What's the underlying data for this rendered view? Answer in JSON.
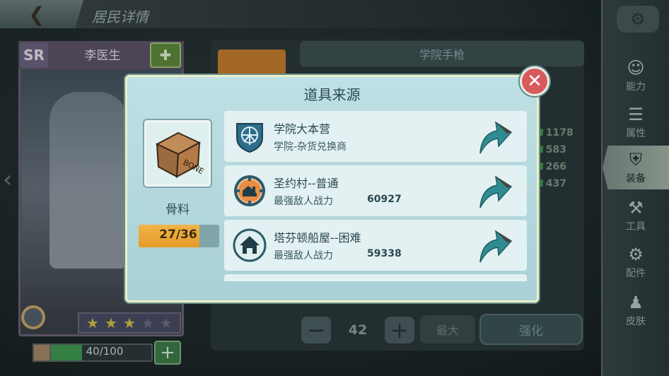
{
  "header": {
    "back_icon": "chevron-left-icon",
    "title": "居民详情"
  },
  "character": {
    "rarity": "SR",
    "name": "李医生",
    "stars_filled": 3,
    "stars_total": 5,
    "xp_text": "40/100",
    "xp_fraction": 0.4
  },
  "sidebar": {
    "items": [
      {
        "label": "能力",
        "icon": "person-icon",
        "active": false
      },
      {
        "label": "属性",
        "icon": "bars-icon",
        "active": false
      },
      {
        "label": "装备",
        "icon": "armor-icon",
        "active": true
      },
      {
        "label": "工具",
        "icon": "hammer-icon",
        "active": false
      },
      {
        "label": "配件",
        "icon": "gear-icon",
        "active": false
      },
      {
        "label": "皮肤",
        "icon": "skin-icon",
        "active": false
      }
    ]
  },
  "equipment": {
    "name": "学院手枪",
    "stats": [
      "1178",
      "583",
      "266",
      "437"
    ],
    "quantity": "42",
    "max_label": "最大",
    "enhance_label": "强化"
  },
  "modal": {
    "title": "道具来源",
    "item_name": "骨料",
    "item_box_text": "BONE",
    "progress_text": "27/36",
    "progress_fraction": 0.75,
    "sources": [
      {
        "title": "学院大本营",
        "subtitle": "学院-杂货兑换商",
        "power": "",
        "icon": "institute-icon"
      },
      {
        "title": "圣约村--普通",
        "subtitle": "最强敌人战力",
        "power": "60927",
        "icon": "settlement-icon"
      },
      {
        "title": "塔芬顿船屋--困难",
        "subtitle": "最强敌人战力",
        "power": "59338",
        "icon": "house-icon"
      }
    ]
  },
  "colors": {
    "accent": "#2f8c93",
    "progress": "#e9a533",
    "close": "#d85a5c"
  }
}
